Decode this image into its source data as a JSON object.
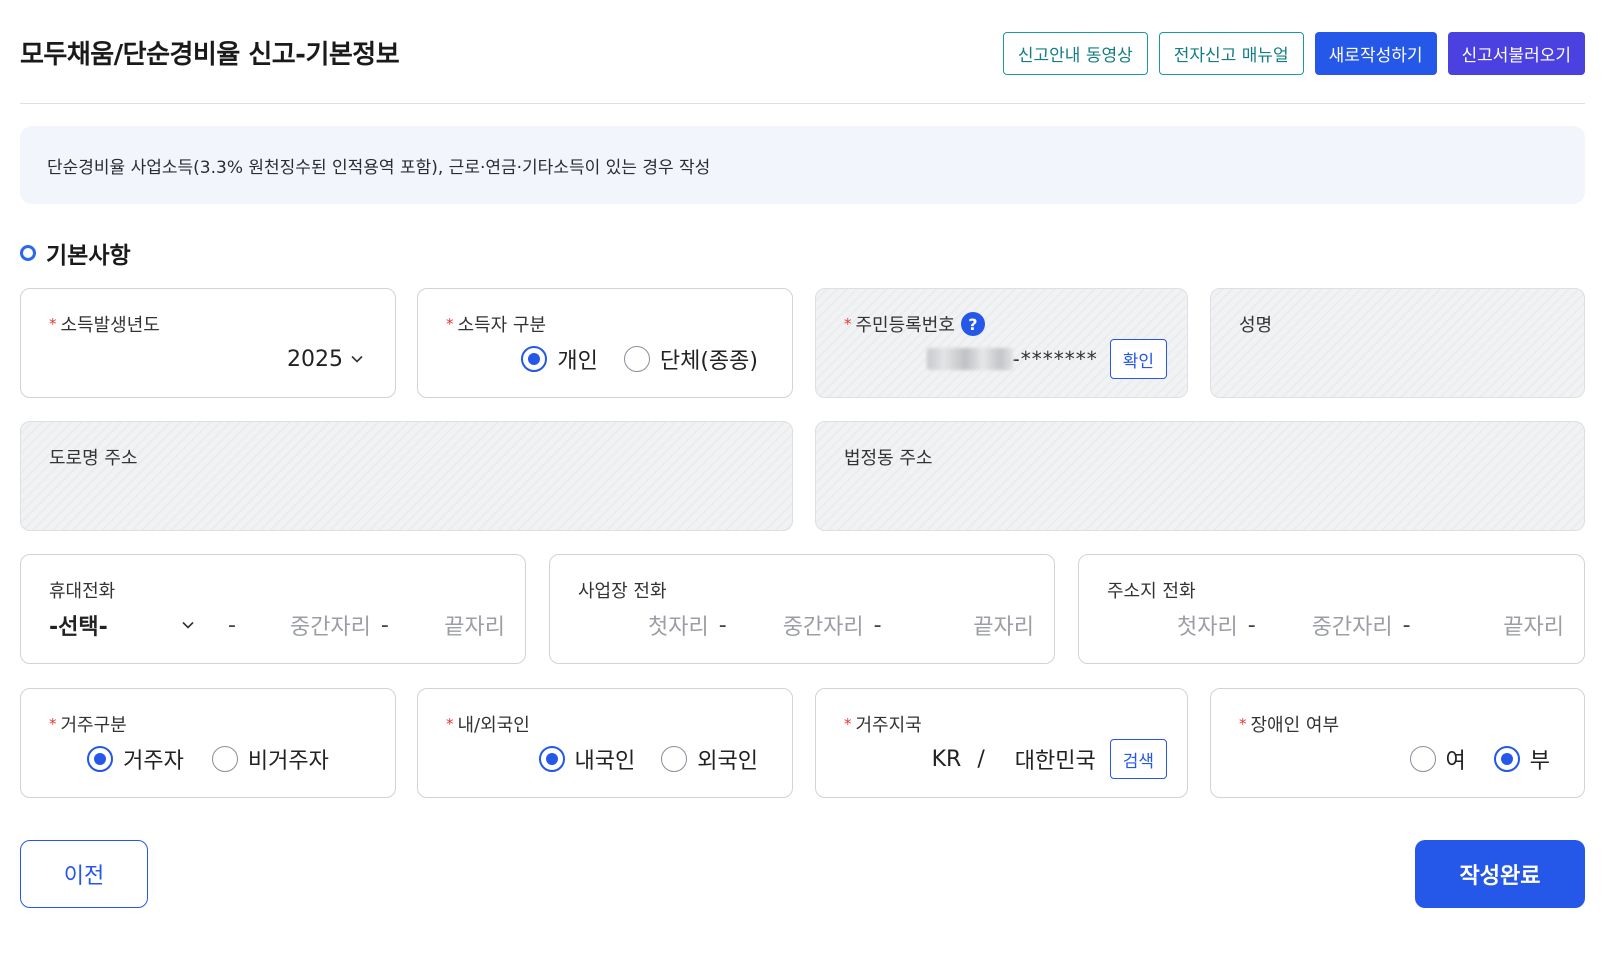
{
  "header": {
    "title": "모두채움/단순경비율 신고-기본정보",
    "buttons": [
      "신고안내 동영상",
      "전자신고 매뉴얼",
      "새로작성하기",
      "신고서불러오기"
    ]
  },
  "notice": "단순경비율 사업소득(3.3% 원천징수된 인적용역 포함), 근로·연금·기타소득이 있는 경우 작성",
  "section_title": "기본사항",
  "fields": {
    "income_year": {
      "label": "소득발생년도",
      "value": "2025"
    },
    "earner_type": {
      "label": "소득자 구분",
      "options": [
        "개인",
        "단체(종종)"
      ],
      "selected": "개인"
    },
    "rrn": {
      "label": "주민등록번호",
      "help": "?",
      "masked": "-*******",
      "confirm": "확인"
    },
    "name": {
      "label": "성명"
    },
    "road_address": {
      "label": "도로명 주소"
    },
    "legal_address": {
      "label": "법정동 주소"
    },
    "mobile": {
      "label": "휴대전화",
      "select": "-선택-",
      "dash": "-",
      "middle": "중간자리",
      "last": "끝자리"
    },
    "business_phone": {
      "label": "사업장 전화",
      "first": "첫자리",
      "dash": "-",
      "middle": "중간자리",
      "last": "끝자리"
    },
    "home_phone": {
      "label": "주소지 전화",
      "first": "첫자리",
      "dash": "-",
      "middle": "중간자리",
      "last": "끝자리"
    },
    "residency": {
      "label": "거주구분",
      "options": [
        "거주자",
        "비거주자"
      ],
      "selected": "거주자"
    },
    "nationality": {
      "label": "내/외국인",
      "options": [
        "내국인",
        "외국인"
      ],
      "selected": "내국인"
    },
    "country": {
      "label": "거주지국",
      "code": "KR",
      "sep": "/",
      "name": "대한민국",
      "search": "검색"
    },
    "disability": {
      "label": "장애인 여부",
      "options": [
        "여",
        "부"
      ],
      "selected": "부"
    }
  },
  "footer": {
    "prev": "이전",
    "done": "작성완료"
  },
  "colors": {
    "primary": "#2557e8",
    "teal": "#1b9aa0",
    "purple": "#4a41e0",
    "required": "#e53935"
  }
}
